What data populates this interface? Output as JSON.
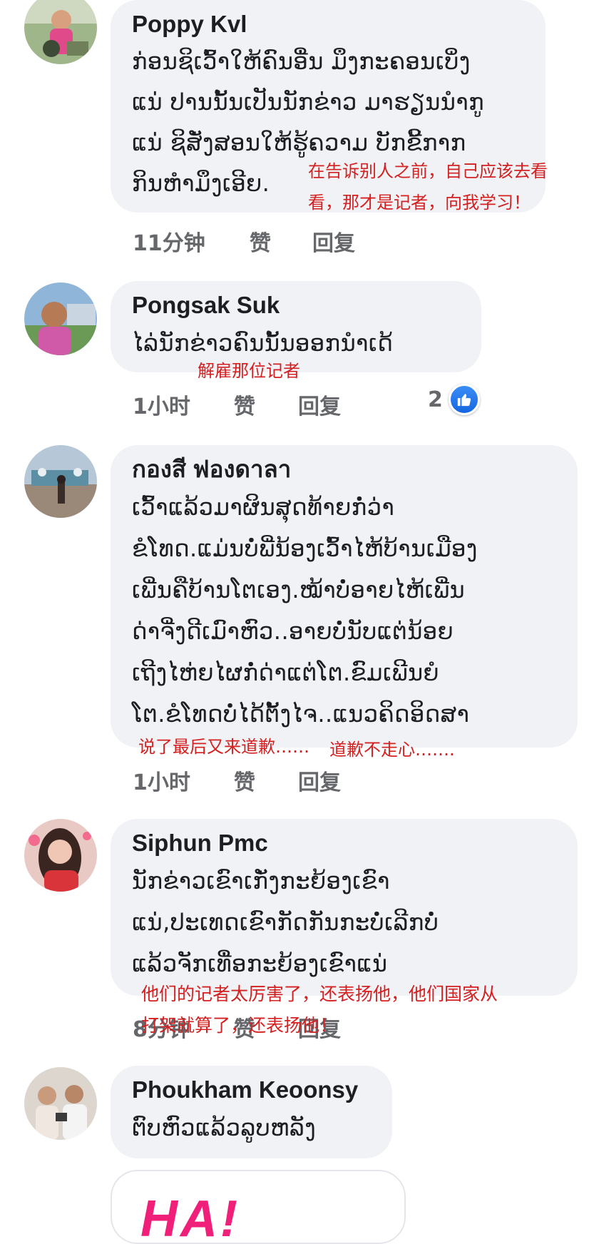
{
  "comments": [
    {
      "author": "Poppy Kvl",
      "text": "ກ່ອນຊິເວົ້າໃຫ້ຄົນອື່ນ ມຶງກະຄອນເບິ່ງ\nແນ່ ປານນັ້ນເປັນນັກຂ່າວ ມາຮຽນນໍາກູ\nແນ່ ຊິສັ່ງສອນໃຫ້ຮູ້ຄວາມ ບັກຂີ້ກາກ\nກິນຫໍາມຶງເອີຍ.",
      "time": "11分钟",
      "like": "赞",
      "reply": "回复",
      "annotation": "在告诉别人之前，自己应该去看\n看，那才是记者，向我学习！"
    },
    {
      "author": "Pongsak Suk",
      "text": "ໄລ່ນັກຂ່າວຄົນນັ້ນອອກນໍາເດ້",
      "time": "1小时",
      "like": "赞",
      "reply": "回复",
      "reaction_count": "2",
      "annotation": "解雇那位记者"
    },
    {
      "author": "กองสี ฟองดาลา",
      "text": "ເວົ້າແລ້ວມາຜິນສຸດທ້າຍກໍ່ວ່າ\nຂໍໂທດ.ແມ່ນບໍ່ພີ່ນ້ອງເວົ້າໄຫ້ບ້ານເມືອງ\nເພີ່ນຄືບ້ານໂຕເອງ.ໝ້າບໍ່ອາຍໄຫ້ເພີ່ນ\nດ່າຈີ່ງດີເມົາຫົວ..ອາຍບໍ່ນັບແຕ່ນ້ອຍ\nເຖີງໄຫ່ຍໄຜກໍ່ດ່າແຕ່ໂຕ.ຂົມເພີນຍໍ\nໂຕ.ຂໍໂທດບໍ່ໄດ້ຕັ້ງໄຈ..ແນວຄິດອິດສາ",
      "time": "1小时",
      "like": "赞",
      "reply": "回复",
      "annotation_a": "说了最后又来道歉……",
      "annotation_b": "道歉不走心……."
    },
    {
      "author": "Siphun Pmc",
      "text": "ນັກຂ່າວເຂົາເກັ່ງກະຍ້ອງເຂົາ\nແນ່,ປະເທດເຂົາກັດກັນກະບໍ່ເລີກບໍ່\nແລ້ວຈັກເທື່ອກະຍ້ອງເຂົາແນ່",
      "time": "8分钟",
      "like": "赞",
      "reply": "回复",
      "annotation": "他们的记者太厉害了，还表扬他，他们国家从\n打架就算了，还表扬他！"
    },
    {
      "author": "Phoukham Keoonsy",
      "text": "ຕົບຫົວແລ້ວລູບຫລັງ"
    }
  ],
  "sticker": {
    "text": "HA!"
  },
  "colors": {
    "bubble": "#f0f2f5",
    "meta": "#65676b",
    "annotation": "#d42020",
    "like": "#1877f2",
    "sticker": "#f0207a"
  }
}
